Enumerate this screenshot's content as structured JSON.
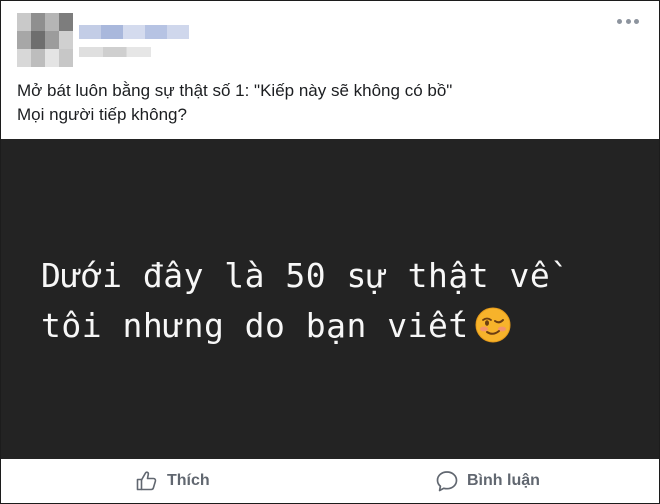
{
  "post": {
    "author_name": "",
    "caption_lines": [
      "Mở bát luôn bằng sự thật số 1: \"Kiếp này sẽ không có bồ\"",
      "Mọi người tiếp không?"
    ],
    "image": {
      "lines": [
        "Dưới đây là 50 sự thật về",
        "tôi nhưng do bạn viết"
      ],
      "emoji": "winking-face"
    }
  },
  "actions": {
    "like_label": "Thích",
    "comment_label": "Bình luận"
  },
  "colors": {
    "image_background": "#232323",
    "action_text": "#616770",
    "caption_text": "#1c1e21"
  }
}
